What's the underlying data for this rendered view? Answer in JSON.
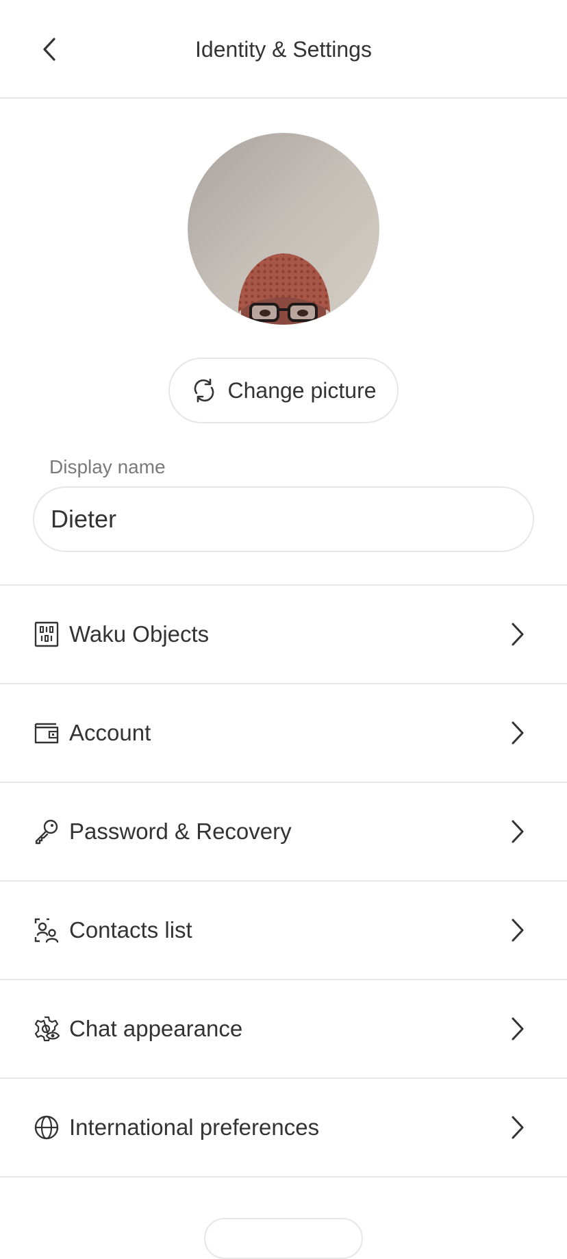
{
  "header": {
    "title": "Identity & Settings",
    "back_icon": "chevron-left-icon"
  },
  "profile": {
    "avatar": "profile-photo",
    "change_picture_label": "Change picture",
    "change_picture_icon": "refresh-icon"
  },
  "display_name": {
    "label": "Display name",
    "value": "Dieter"
  },
  "menu": {
    "items": [
      {
        "label": "Waku Objects",
        "icon": "objects-grid-icon"
      },
      {
        "label": "Account",
        "icon": "wallet-icon"
      },
      {
        "label": "Password & Recovery",
        "icon": "key-icon"
      },
      {
        "label": "Contacts list",
        "icon": "contacts-icon"
      },
      {
        "label": "Chat appearance",
        "icon": "settings-view-icon"
      },
      {
        "label": "International preferences",
        "icon": "globe-icon"
      }
    ]
  },
  "colors": {
    "text": "#333333",
    "muted": "#7a7a7a",
    "divider": "#e6e6e6",
    "background": "#ffffff"
  }
}
